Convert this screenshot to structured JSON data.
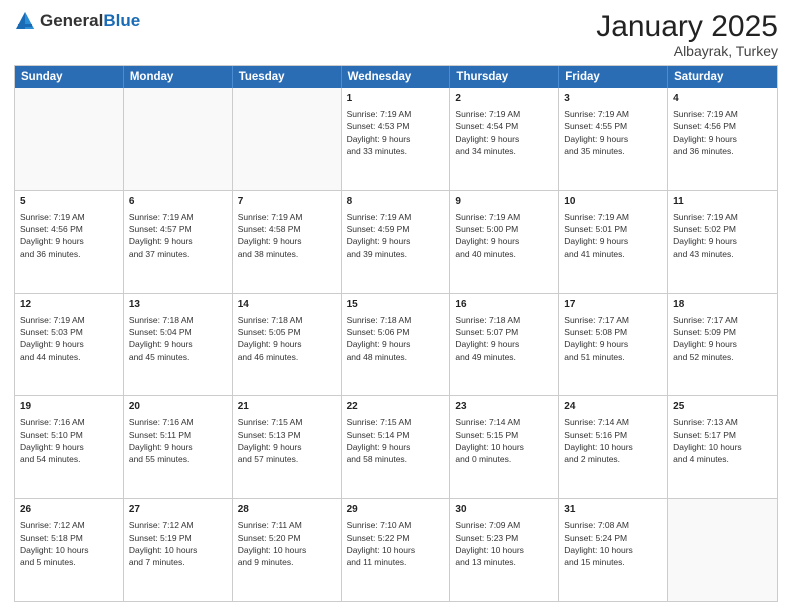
{
  "header": {
    "logo": {
      "general": "General",
      "blue": "Blue"
    },
    "title": "January 2025",
    "subtitle": "Albayrak, Turkey"
  },
  "calendar": {
    "days_of_week": [
      "Sunday",
      "Monday",
      "Tuesday",
      "Wednesday",
      "Thursday",
      "Friday",
      "Saturday"
    ],
    "weeks": [
      [
        {
          "day": "",
          "info": ""
        },
        {
          "day": "",
          "info": ""
        },
        {
          "day": "",
          "info": ""
        },
        {
          "day": "1",
          "info": "Sunrise: 7:19 AM\nSunset: 4:53 PM\nDaylight: 9 hours\nand 33 minutes."
        },
        {
          "day": "2",
          "info": "Sunrise: 7:19 AM\nSunset: 4:54 PM\nDaylight: 9 hours\nand 34 minutes."
        },
        {
          "day": "3",
          "info": "Sunrise: 7:19 AM\nSunset: 4:55 PM\nDaylight: 9 hours\nand 35 minutes."
        },
        {
          "day": "4",
          "info": "Sunrise: 7:19 AM\nSunset: 4:56 PM\nDaylight: 9 hours\nand 36 minutes."
        }
      ],
      [
        {
          "day": "5",
          "info": "Sunrise: 7:19 AM\nSunset: 4:56 PM\nDaylight: 9 hours\nand 36 minutes."
        },
        {
          "day": "6",
          "info": "Sunrise: 7:19 AM\nSunset: 4:57 PM\nDaylight: 9 hours\nand 37 minutes."
        },
        {
          "day": "7",
          "info": "Sunrise: 7:19 AM\nSunset: 4:58 PM\nDaylight: 9 hours\nand 38 minutes."
        },
        {
          "day": "8",
          "info": "Sunrise: 7:19 AM\nSunset: 4:59 PM\nDaylight: 9 hours\nand 39 minutes."
        },
        {
          "day": "9",
          "info": "Sunrise: 7:19 AM\nSunset: 5:00 PM\nDaylight: 9 hours\nand 40 minutes."
        },
        {
          "day": "10",
          "info": "Sunrise: 7:19 AM\nSunset: 5:01 PM\nDaylight: 9 hours\nand 41 minutes."
        },
        {
          "day": "11",
          "info": "Sunrise: 7:19 AM\nSunset: 5:02 PM\nDaylight: 9 hours\nand 43 minutes."
        }
      ],
      [
        {
          "day": "12",
          "info": "Sunrise: 7:19 AM\nSunset: 5:03 PM\nDaylight: 9 hours\nand 44 minutes."
        },
        {
          "day": "13",
          "info": "Sunrise: 7:18 AM\nSunset: 5:04 PM\nDaylight: 9 hours\nand 45 minutes."
        },
        {
          "day": "14",
          "info": "Sunrise: 7:18 AM\nSunset: 5:05 PM\nDaylight: 9 hours\nand 46 minutes."
        },
        {
          "day": "15",
          "info": "Sunrise: 7:18 AM\nSunset: 5:06 PM\nDaylight: 9 hours\nand 48 minutes."
        },
        {
          "day": "16",
          "info": "Sunrise: 7:18 AM\nSunset: 5:07 PM\nDaylight: 9 hours\nand 49 minutes."
        },
        {
          "day": "17",
          "info": "Sunrise: 7:17 AM\nSunset: 5:08 PM\nDaylight: 9 hours\nand 51 minutes."
        },
        {
          "day": "18",
          "info": "Sunrise: 7:17 AM\nSunset: 5:09 PM\nDaylight: 9 hours\nand 52 minutes."
        }
      ],
      [
        {
          "day": "19",
          "info": "Sunrise: 7:16 AM\nSunset: 5:10 PM\nDaylight: 9 hours\nand 54 minutes."
        },
        {
          "day": "20",
          "info": "Sunrise: 7:16 AM\nSunset: 5:11 PM\nDaylight: 9 hours\nand 55 minutes."
        },
        {
          "day": "21",
          "info": "Sunrise: 7:15 AM\nSunset: 5:13 PM\nDaylight: 9 hours\nand 57 minutes."
        },
        {
          "day": "22",
          "info": "Sunrise: 7:15 AM\nSunset: 5:14 PM\nDaylight: 9 hours\nand 58 minutes."
        },
        {
          "day": "23",
          "info": "Sunrise: 7:14 AM\nSunset: 5:15 PM\nDaylight: 10 hours\nand 0 minutes."
        },
        {
          "day": "24",
          "info": "Sunrise: 7:14 AM\nSunset: 5:16 PM\nDaylight: 10 hours\nand 2 minutes."
        },
        {
          "day": "25",
          "info": "Sunrise: 7:13 AM\nSunset: 5:17 PM\nDaylight: 10 hours\nand 4 minutes."
        }
      ],
      [
        {
          "day": "26",
          "info": "Sunrise: 7:12 AM\nSunset: 5:18 PM\nDaylight: 10 hours\nand 5 minutes."
        },
        {
          "day": "27",
          "info": "Sunrise: 7:12 AM\nSunset: 5:19 PM\nDaylight: 10 hours\nand 7 minutes."
        },
        {
          "day": "28",
          "info": "Sunrise: 7:11 AM\nSunset: 5:20 PM\nDaylight: 10 hours\nand 9 minutes."
        },
        {
          "day": "29",
          "info": "Sunrise: 7:10 AM\nSunset: 5:22 PM\nDaylight: 10 hours\nand 11 minutes."
        },
        {
          "day": "30",
          "info": "Sunrise: 7:09 AM\nSunset: 5:23 PM\nDaylight: 10 hours\nand 13 minutes."
        },
        {
          "day": "31",
          "info": "Sunrise: 7:08 AM\nSunset: 5:24 PM\nDaylight: 10 hours\nand 15 minutes."
        },
        {
          "day": "",
          "info": ""
        }
      ]
    ]
  }
}
